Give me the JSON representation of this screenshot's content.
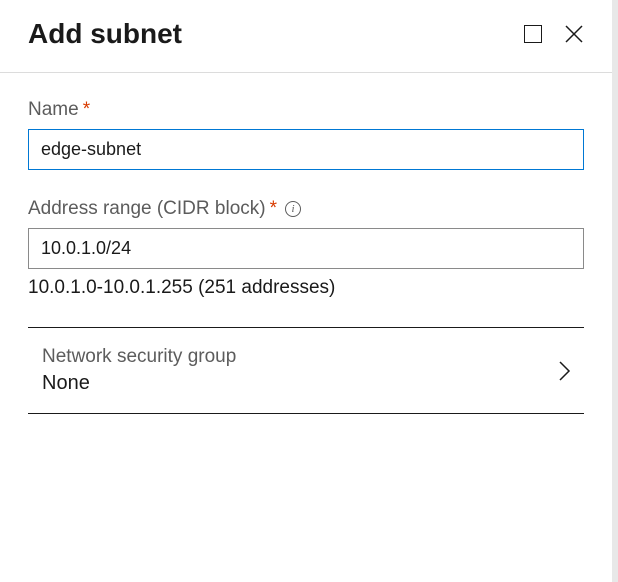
{
  "header": {
    "title": "Add subnet"
  },
  "fields": {
    "name": {
      "label": "Name",
      "value": "edge-subnet"
    },
    "address_range": {
      "label": "Address range (CIDR block)",
      "value": "10.0.1.0/24",
      "helper": "10.0.1.0-10.0.1.255 (251 addresses)"
    }
  },
  "sections": {
    "nsg": {
      "label": "Network security group",
      "value": "None"
    }
  }
}
